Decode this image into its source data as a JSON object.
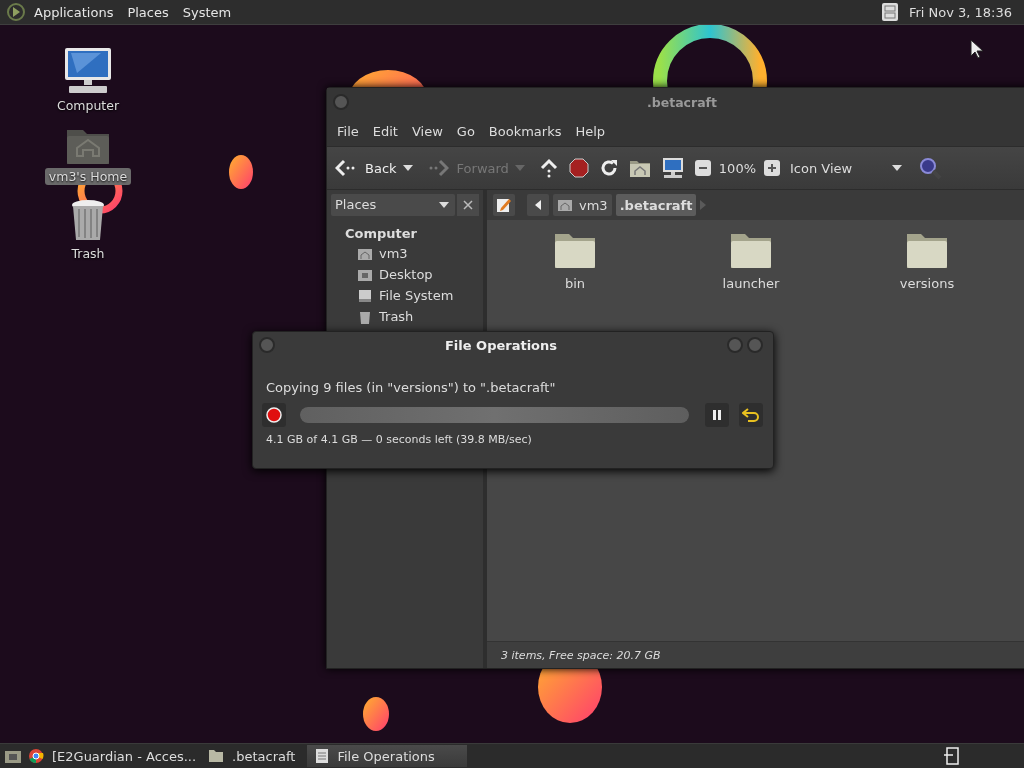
{
  "top_panel": {
    "menus": [
      {
        "label": "Applications"
      },
      {
        "label": "Places"
      },
      {
        "label": "System"
      }
    ],
    "clock": "Fri Nov 3, 18:36"
  },
  "desktop_icons": [
    {
      "label": "Computer",
      "kind": "computer",
      "selected": false
    },
    {
      "label": "vm3's Home",
      "kind": "home",
      "selected": true
    },
    {
      "label": "Trash",
      "kind": "trash",
      "selected": false
    }
  ],
  "file_manager": {
    "title": ".betacraft",
    "menu": [
      {
        "label": "File"
      },
      {
        "label": "Edit"
      },
      {
        "label": "View"
      },
      {
        "label": "Go"
      },
      {
        "label": "Bookmarks"
      },
      {
        "label": "Help"
      }
    ],
    "toolbar": {
      "back": {
        "label": "Back",
        "disabled": false
      },
      "forward": {
        "label": "Forward",
        "disabled": true
      },
      "zoom": "100%",
      "view": "Icon View"
    },
    "sidebar": {
      "selector": "Places",
      "heading": "Computer",
      "items": [
        {
          "label": "vm3",
          "kind": "home"
        },
        {
          "label": "Desktop",
          "kind": "desktop"
        },
        {
          "label": "File System",
          "kind": "drive"
        },
        {
          "label": "Trash",
          "kind": "trash"
        }
      ]
    },
    "path": [
      {
        "label": "vm3",
        "kind": "home",
        "selected": false
      },
      {
        "label": ".betacraft",
        "kind": "folder",
        "selected": true
      }
    ],
    "files": [
      {
        "name": "bin"
      },
      {
        "name": "launcher"
      },
      {
        "name": "versions"
      }
    ],
    "status": "3 items, Free space: 20.7 GB"
  },
  "dialog": {
    "title": "File Operations",
    "message": "Copying 9 files (in \"versions\") to \".betacraft\"",
    "level": 1,
    "detail": "4.1 GB of 4.1 GB — 0 seconds left (39.8 MB/sec)"
  },
  "taskbar": {
    "items": [
      {
        "label": "[E2Guardian - Acces...",
        "kind": "browser",
        "selected": false
      },
      {
        "label": ".betacraft",
        "kind": "folder",
        "selected": false
      },
      {
        "label": "File Operations",
        "kind": "dialog",
        "selected": true
      }
    ]
  }
}
